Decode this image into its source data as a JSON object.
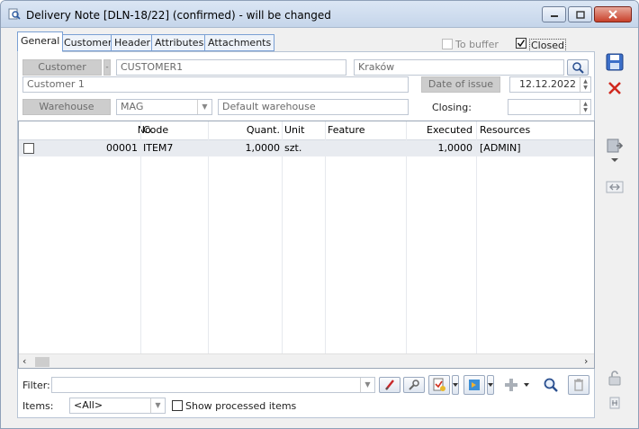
{
  "window": {
    "title": "Delivery Note [DLN-18/22] (confirmed) - will be changed"
  },
  "tabs": [
    {
      "label": "General"
    },
    {
      "label": "Customer"
    },
    {
      "label": "Header"
    },
    {
      "label": "Attributes"
    },
    {
      "label": "Attachments"
    }
  ],
  "header": {
    "to_buffer_label": "To buffer",
    "closed_label": "Closed",
    "customer_button": "Customer",
    "customer_code": "CUSTOMER1",
    "customer_city": "Kraków",
    "customer_name": "Customer 1",
    "date_of_issue_button": "Date of issue",
    "date_of_issue": "12.12.2022",
    "warehouse_button": "Warehouse",
    "warehouse_code": "MAG",
    "warehouse_name": "Default warehouse",
    "closing_label": "Closing:",
    "closing_value": ""
  },
  "grid": {
    "columns": [
      "No.",
      "Code",
      "Quant.",
      "Unit",
      "Feature",
      "Executed",
      "Resources"
    ],
    "rows": [
      {
        "no": "00001",
        "code": "ITEM7",
        "quant": "1,0000",
        "unit": "szt.",
        "feature": "",
        "executed": "1,0000",
        "resources": "[ADMIN]"
      }
    ]
  },
  "filter": {
    "label": "Filter:",
    "value": ""
  },
  "items": {
    "label": "Items:",
    "selected": "<All>",
    "show_processed_label": "Show processed items"
  },
  "colors": {
    "accent": "#3c6fc8",
    "delete_red": "#d0281e"
  }
}
